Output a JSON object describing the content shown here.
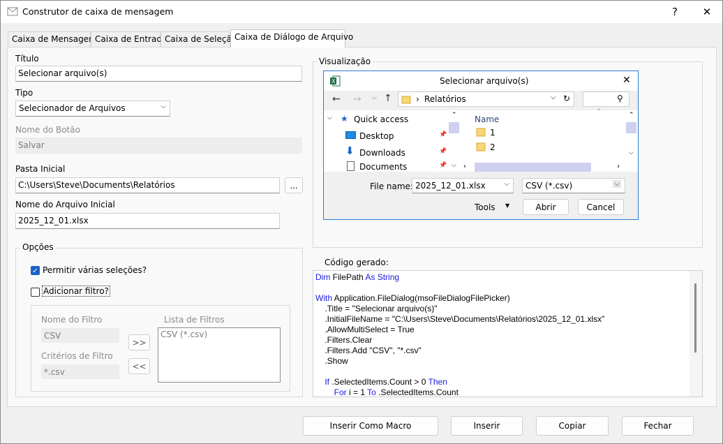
{
  "window": {
    "title": "Construtor de caixa de mensagem",
    "help_label": "?",
    "close_label": "✕"
  },
  "tabs": [
    {
      "label": "Caixa de Mensagem"
    },
    {
      "label": "Caixa de Entrada"
    },
    {
      "label": "Caixa de Seleção"
    },
    {
      "label": "Caixa de Diálogo de Arquivo"
    }
  ],
  "form": {
    "title_label": "Título",
    "title_value": "Selecionar arquivo(s)",
    "type_label": "Tipo",
    "type_value": "Selecionador de Arquivos",
    "button_name_label": "Nome do Botão",
    "button_name_value": "Salvar",
    "initial_folder_label": "Pasta Inicial",
    "initial_folder_value": "C:\\Users\\Steve\\Documents\\Relatórios",
    "browse_label": "...",
    "initial_file_label": "Nome do Arquivo Inicial",
    "initial_file_value": "2025_12_01.xlsx"
  },
  "options": {
    "group_label": "Opções",
    "multi_select_label": "Permitir várias seleções?",
    "multi_select_checked": true,
    "add_filter_label": "Adicionar filtro?",
    "add_filter_checked": false,
    "filter_name_label": "Nome do Filtro",
    "filter_name_value": "CSV",
    "filter_criteria_label": "Critérios de Filtro",
    "filter_criteria_value": "*.csv",
    "filter_list_label": "Lista de Filtros",
    "filter_list_items": [
      "CSV (*.csv)"
    ],
    "add_arrow_label": ">>",
    "remove_arrow_label": "<<"
  },
  "preview": {
    "group_label": "Visualização",
    "dialog_title": "Selecionar arquivo(s)",
    "close_label": "✕",
    "breadcrumb": "Relatórios",
    "breadcrumb_sep": "›",
    "nav": {
      "quick_access": "Quick access",
      "desktop": "Desktop",
      "downloads": "Downloads",
      "documents": "Documents"
    },
    "column_header": "Name",
    "files": [
      "1",
      "2"
    ],
    "file_name_label": "File name:",
    "file_name_value": "2025_12_01.xlsx",
    "filter_value": "CSV (*.csv)",
    "tools_label": "Tools",
    "open_label": "Abrir",
    "cancel_label": "Cancel"
  },
  "code": {
    "label": "Código gerado:",
    "lines": [
      {
        "kw1": "Dim ",
        "text": "FilePath ",
        "kw2": "As String",
        "rest": ""
      },
      {
        "kw1": "",
        "text": "",
        "kw2": "",
        "rest": ""
      },
      {
        "kw1": "With ",
        "text": "Application.FileDialog(msoFileDialogFilePicker)",
        "kw2": "",
        "rest": ""
      },
      {
        "kw1": "",
        "text": "    .Title = \"Selecionar arquivo(s)\"",
        "kw2": "",
        "rest": ""
      },
      {
        "kw1": "",
        "text": "    .InitialFileName = \"C:\\Users\\Steve\\Documents\\Relatórios\\2025_12_01.xlsx\"",
        "kw2": "",
        "rest": ""
      },
      {
        "kw1": "",
        "text": "    .AllowMultiSelect = True",
        "kw2": "",
        "rest": ""
      },
      {
        "kw1": "",
        "text": "    .Filters.Clear",
        "kw2": "",
        "rest": ""
      },
      {
        "kw1": "",
        "text": "    .Filters.Add \"CSV\", \"*.csv\"",
        "kw2": "",
        "rest": ""
      },
      {
        "kw1": "",
        "text": "    .Show",
        "kw2": "",
        "rest": ""
      },
      {
        "kw1": "",
        "text": "",
        "kw2": "",
        "rest": ""
      },
      {
        "kw1": "    If ",
        "text": ".SelectedItems.Count > 0 ",
        "kw2": "Then",
        "rest": ""
      },
      {
        "kw1": "        For ",
        "text": "i = 1 ",
        "kw2": "To ",
        "rest": ".SelectedItems.Count"
      }
    ]
  },
  "buttons": {
    "insert_macro": "Inserir Como Macro",
    "insert": "Inserir",
    "copy": "Copiar",
    "close": "Fechar"
  }
}
